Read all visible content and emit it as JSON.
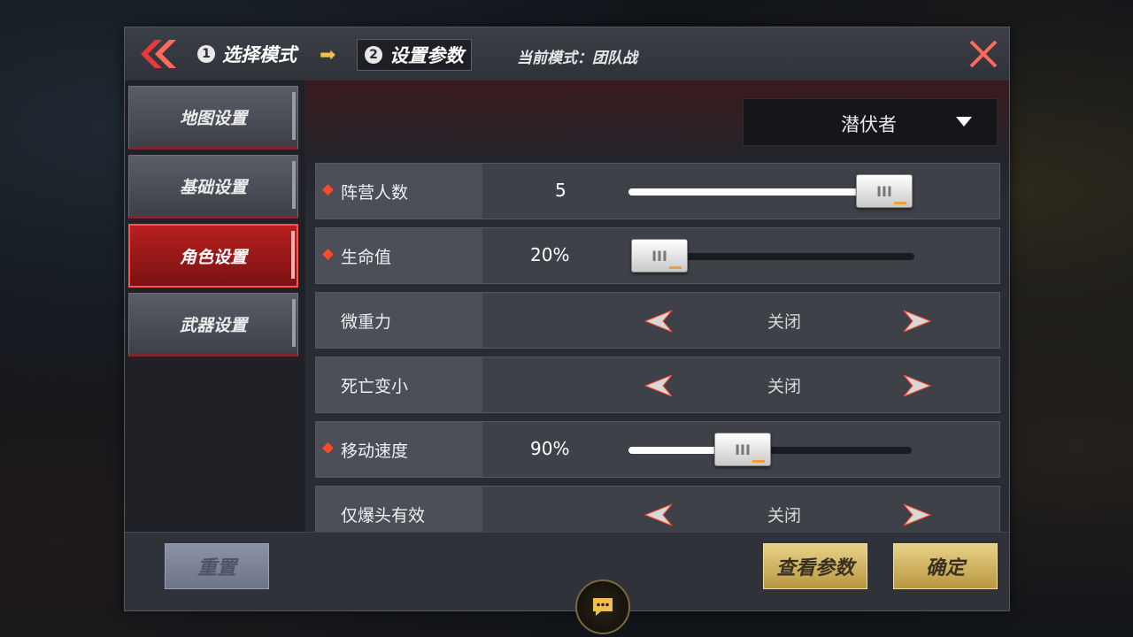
{
  "header": {
    "step1_number": "1",
    "step1_label": "选择模式",
    "step2_number": "2",
    "step2_label": "设置参数",
    "current_mode": "当前模式：团队战"
  },
  "sidebar": {
    "items": [
      {
        "label": "地图设置",
        "active": false
      },
      {
        "label": "基础设置",
        "active": false
      },
      {
        "label": "角色设置",
        "active": true
      },
      {
        "label": "武器设置",
        "active": false
      }
    ]
  },
  "content": {
    "dropdown_value": "潜伏者",
    "rows": [
      {
        "label": "阵营人数",
        "type": "slider",
        "value": "5",
        "fraction": 0.9,
        "marked": true
      },
      {
        "label": "生命值",
        "type": "slider",
        "value": "20%",
        "fraction": 0.0,
        "marked": true
      },
      {
        "label": "微重力",
        "type": "toggle",
        "value": "关闭",
        "marked": false
      },
      {
        "label": "死亡变小",
        "type": "toggle",
        "value": "关闭",
        "marked": false
      },
      {
        "label": "移动速度",
        "type": "slider",
        "value": "90%",
        "fraction": 0.4,
        "marked": true
      },
      {
        "label": "仅爆头有效",
        "type": "toggle",
        "value": "关闭",
        "marked": false
      }
    ]
  },
  "footer": {
    "reset_label": "重置",
    "view_params_label": "查看参数",
    "confirm_label": "确定"
  },
  "colors": {
    "accent_red": "#b82020",
    "gold": "#e8d28a",
    "marker": "#ff4a2a"
  }
}
